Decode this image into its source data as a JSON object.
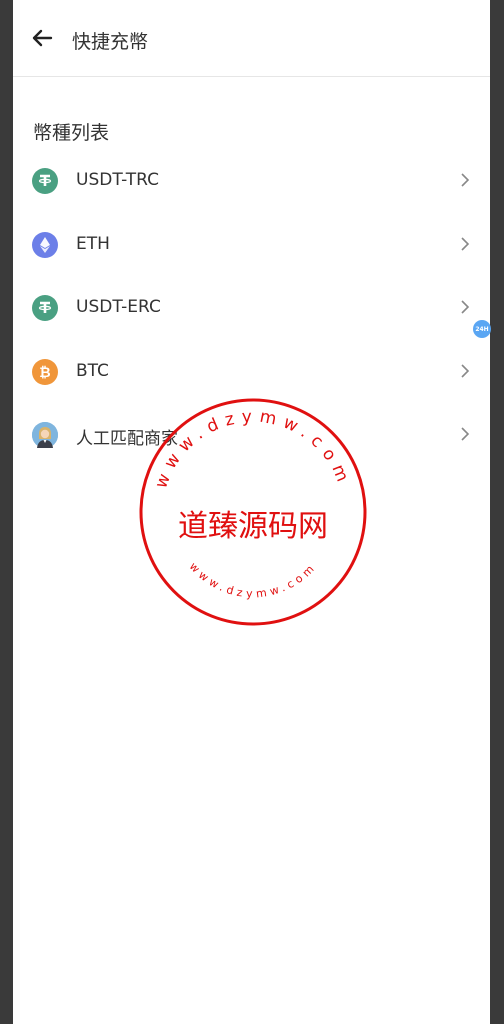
{
  "header": {
    "title": "快捷充幣"
  },
  "section": {
    "title": "幣種列表"
  },
  "coins": [
    {
      "label": "USDT-TRC",
      "icon": "tether-icon",
      "color": "#4aa082"
    },
    {
      "label": "ETH",
      "icon": "ethereum-icon",
      "color": "#6c7fe8"
    },
    {
      "label": "USDT-ERC",
      "icon": "tether-icon",
      "color": "#4aa082"
    },
    {
      "label": "BTC",
      "icon": "bitcoin-icon",
      "color": "#f0963a"
    },
    {
      "label": "人工匹配商家",
      "icon": "merchant-avatar-icon",
      "color": "#7fb5de"
    }
  ],
  "side_badge": {
    "text": "24H"
  },
  "watermark": {
    "center_text": "道臻源码网",
    "top_ring_text": "www.dzymw.com",
    "bottom_ring_text": "www.dzymw.com",
    "color": "#e01010"
  }
}
